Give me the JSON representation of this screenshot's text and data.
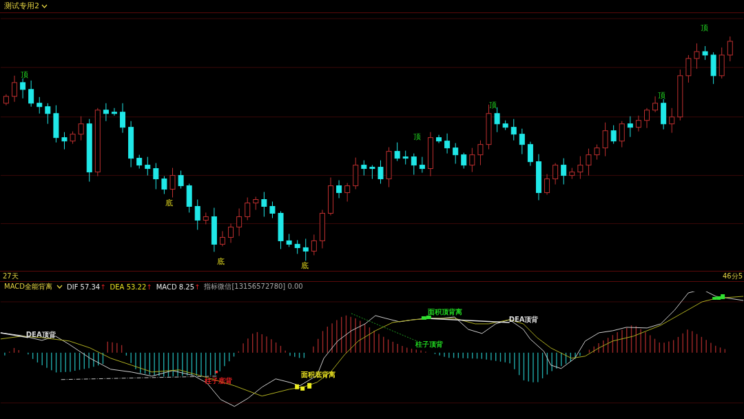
{
  "header": {
    "title": "测试专用2"
  },
  "main_chart": {
    "signals": [
      {
        "text": "顶",
        "kind": "top"
      },
      {
        "text": "底",
        "kind": "bottom"
      },
      {
        "text": "底",
        "kind": "bottom"
      },
      {
        "text": "底",
        "kind": "bottom"
      },
      {
        "text": "顶",
        "kind": "top"
      },
      {
        "text": "顶",
        "kind": "top"
      },
      {
        "text": "顶",
        "kind": "top"
      },
      {
        "text": "顶",
        "kind": "top"
      }
    ]
  },
  "period_label": "27天",
  "time_label": "46分5",
  "indicator": {
    "name": "MACD全能背离",
    "values": [
      {
        "text": "DIF 57.34",
        "arrow": "↑",
        "kind": "dif"
      },
      {
        "text": "DEA 53.22",
        "arrow": "↑",
        "kind": "dea"
      },
      {
        "text": "MACD 8.25",
        "arrow": "↑",
        "kind": "macd"
      }
    ],
    "note": "指标微信[13156572780] 0.00"
  },
  "macd_chart": {
    "labels": [
      {
        "text": "DEA顶背",
        "color": "#d8d8d8"
      },
      {
        "text": "柱子底背",
        "color": "#e02020"
      },
      {
        "text": "面积底背离",
        "color": "#e8e020"
      },
      {
        "text": "面积顶背离",
        "color": "#20d020"
      },
      {
        "text": "柱子顶背",
        "color": "#20d020"
      },
      {
        "text": "DEA顶背",
        "color": "#d8d8d8"
      }
    ]
  }
}
